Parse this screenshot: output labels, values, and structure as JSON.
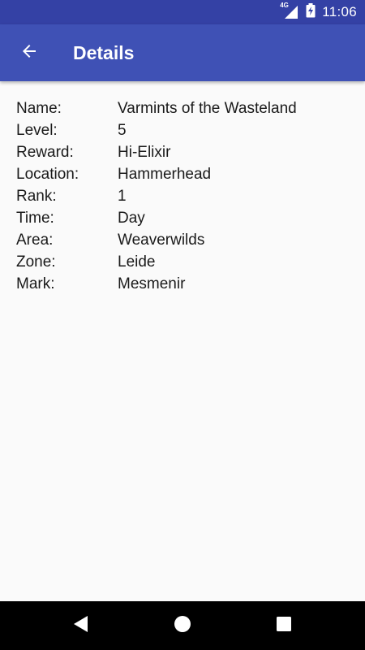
{
  "status_bar": {
    "network": "4G",
    "time": "11:06",
    "icons": [
      "signal-icon",
      "battery-charging-icon"
    ]
  },
  "app_bar": {
    "title": "Details",
    "back_icon": "arrow-back-icon",
    "color": "#3f51b5"
  },
  "details": [
    {
      "label": "Name:",
      "value": "Varmints of the Wasteland"
    },
    {
      "label": "Level:",
      "value": "5"
    },
    {
      "label": "Reward:",
      "value": "Hi-Elixir"
    },
    {
      "label": "Location:",
      "value": "Hammerhead"
    },
    {
      "label": "Rank:",
      "value": "1"
    },
    {
      "label": "Time:",
      "value": "Day"
    },
    {
      "label": "Area:",
      "value": "Weaverwilds"
    },
    {
      "label": "Zone:",
      "value": "Leide"
    },
    {
      "label": "Mark:",
      "value": "Mesmenir"
    }
  ],
  "nav_bar": {
    "icons": [
      "back-triangle-icon",
      "home-circle-icon",
      "recents-square-icon"
    ]
  }
}
